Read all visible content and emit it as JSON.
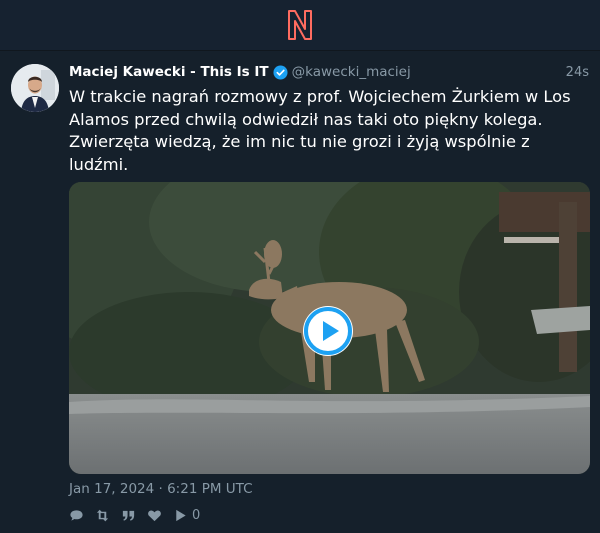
{
  "header": {
    "logo_icon": "nitter-n-logo",
    "logo_color": "#ff6c60"
  },
  "tweet": {
    "author": {
      "display_name": "Maciej Kawecki - This Is IT",
      "handle": "@kawecki_maciej",
      "verified": true,
      "verified_color": "#1da1f2"
    },
    "relative_time": "24s",
    "text": "W trakcie nagrań rozmowy z prof. Wojciechem Żurkiem w Los Alamos przed chwilą odwiedził nas taki oto piękny kolega. Zwierzęta wiedzą, że im nic tu nie grozi i żyją wspólnie z ludźmi.",
    "media": {
      "type": "video",
      "play_icon": "play-icon",
      "accent": "#1da1f2"
    },
    "timestamp": "Jan 17, 2024 · 6:21 PM UTC",
    "stats": {
      "replies_icon": "comment-icon",
      "retweets_icon": "retweet-icon",
      "quotes_icon": "quote-icon",
      "likes_icon": "heart-icon",
      "views_icon": "play-count-icon",
      "views": "0"
    }
  }
}
